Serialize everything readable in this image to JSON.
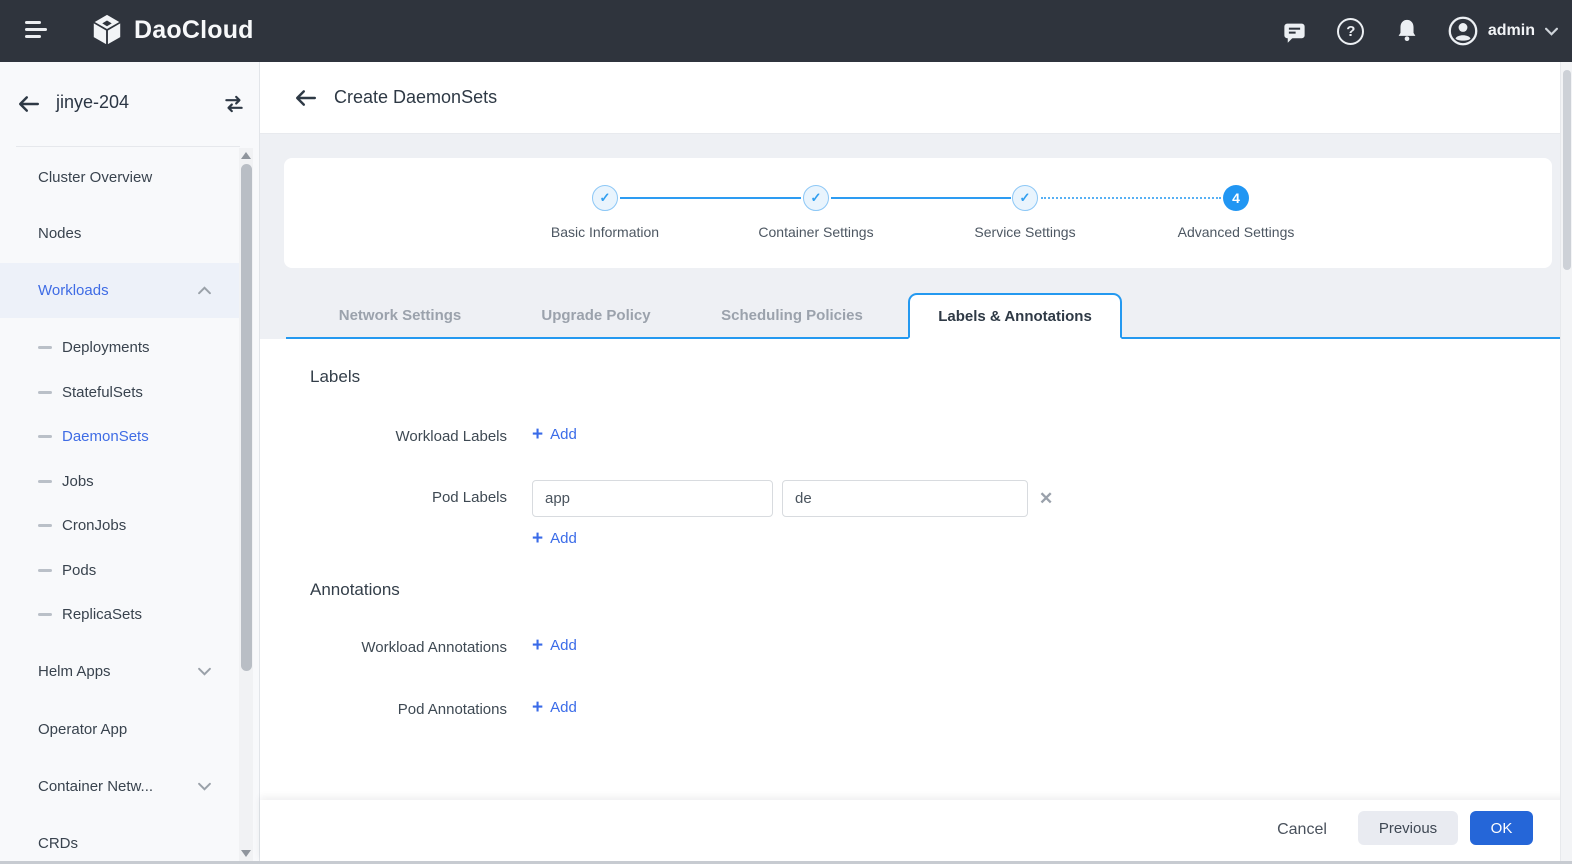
{
  "topbar": {
    "brand": "DaoCloud",
    "user": "admin"
  },
  "sidebar": {
    "cluster": "jinye-204",
    "items": [
      {
        "label": "Cluster Overview"
      },
      {
        "label": "Nodes"
      },
      {
        "label": "Workloads"
      },
      {
        "label": "Deployments"
      },
      {
        "label": "StatefulSets"
      },
      {
        "label": "DaemonSets"
      },
      {
        "label": "Jobs"
      },
      {
        "label": "CronJobs"
      },
      {
        "label": "Pods"
      },
      {
        "label": "ReplicaSets"
      },
      {
        "label": "Helm Apps"
      },
      {
        "label": "Operator App"
      },
      {
        "label": "Container Netw..."
      },
      {
        "label": "CRDs"
      }
    ]
  },
  "header": {
    "title": "Create DaemonSets"
  },
  "stepper": {
    "steps": [
      {
        "label": "Basic Information",
        "state": "done"
      },
      {
        "label": "Container Settings",
        "state": "done"
      },
      {
        "label": "Service Settings",
        "state": "done"
      },
      {
        "label": "Advanced Settings",
        "state": "current",
        "number": "4"
      }
    ]
  },
  "tabs": [
    {
      "label": "Network Settings",
      "active": false
    },
    {
      "label": "Upgrade Policy",
      "active": false
    },
    {
      "label": "Scheduling Policies",
      "active": false
    },
    {
      "label": "Labels & Annotations",
      "active": true
    }
  ],
  "form": {
    "labels_heading": "Labels",
    "workload_labels_label": "Workload Labels",
    "pod_labels_label": "Pod Labels",
    "pod_label_key": "app",
    "pod_label_value": "de",
    "add_label": "Add",
    "annotations_heading": "Annotations",
    "workload_annotations_label": "Workload Annotations",
    "pod_annotations_label": "Pod Annotations"
  },
  "footer": {
    "cancel": "Cancel",
    "previous": "Previous",
    "ok": "OK"
  },
  "icons": {
    "plus": "+",
    "close": "✕",
    "help": "?",
    "check": "✓"
  },
  "colors": {
    "topbar_bg": "#2f343d",
    "accent_blue": "#2196f3",
    "link_blue": "#3a6be8",
    "sidebar_active_blue": "#3f6ce5",
    "ok_button": "#2566d8",
    "content_bg": "#eef0f4"
  }
}
